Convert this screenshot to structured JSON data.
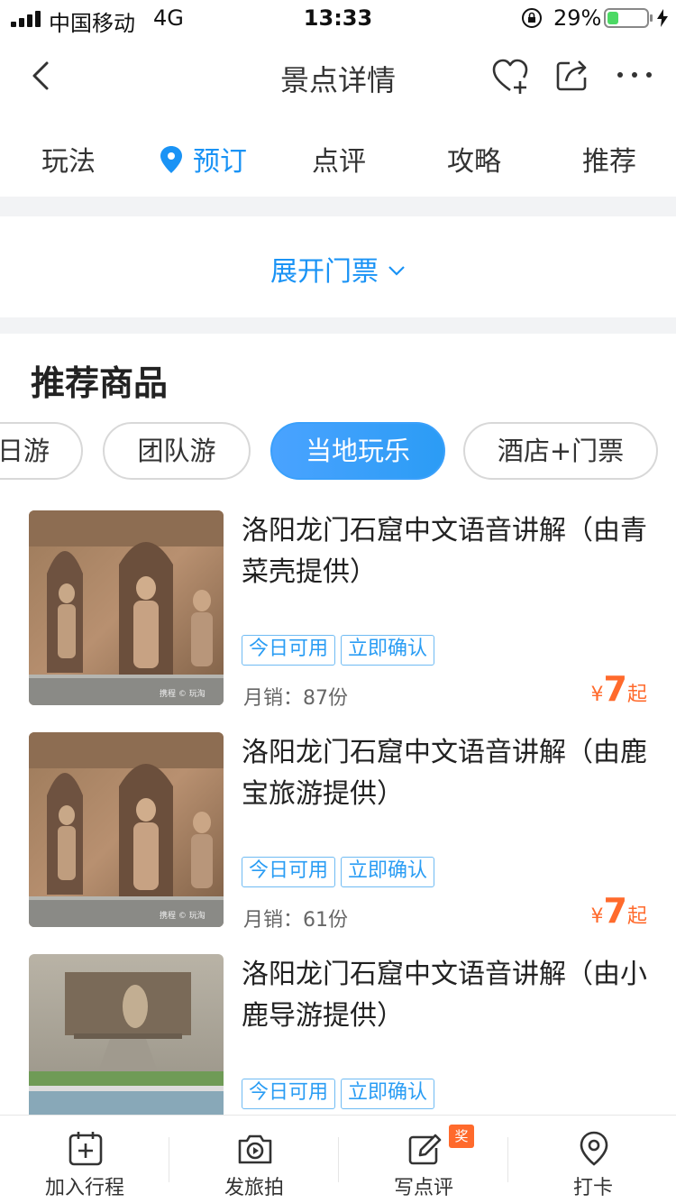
{
  "status_bar": {
    "carrier": "中国移动",
    "network": "4G",
    "time": "13:33",
    "battery_percent_text": "29%",
    "battery_level": 0.29
  },
  "nav": {
    "title": "景点详情",
    "icons": [
      "back-icon",
      "heart-add-icon",
      "share-icon",
      "more-icon"
    ]
  },
  "tabs": [
    {
      "label": "玩法",
      "active": false
    },
    {
      "label": "预订",
      "active": true
    },
    {
      "label": "点评",
      "active": false
    },
    {
      "label": "攻略",
      "active": false
    },
    {
      "label": "推荐",
      "active": false
    }
  ],
  "expand": {
    "label": "展开门票"
  },
  "section": {
    "title": "推荐商品"
  },
  "chips": [
    {
      "label": "日游",
      "active": false
    },
    {
      "label": "团队游",
      "active": false
    },
    {
      "label": "当地玩乐",
      "active": true
    },
    {
      "label": "酒店+门票",
      "active": false
    }
  ],
  "products": [
    {
      "title": "洛阳龙门石窟中文语音讲解（由青菜壳提供）",
      "tags": [
        "今日可用",
        "立即确认"
      ],
      "sales": "月销：87份",
      "price_currency": "¥",
      "price_value": "7",
      "price_suffix": "起",
      "watermark": "携程 © 玩淘"
    },
    {
      "title": "洛阳龙门石窟中文语音讲解（由鹿宝旅游提供）",
      "tags": [
        "今日可用",
        "立即确认"
      ],
      "sales": "月销：61份",
      "price_currency": "¥",
      "price_value": "7",
      "price_suffix": "起",
      "watermark": "携程 © 玩淘"
    },
    {
      "title": "洛阳龙门石窟中文语音讲解（由小鹿导游提供）",
      "tags": [
        "今日可用",
        "立即确认"
      ]
    }
  ],
  "bottom_bar": [
    {
      "label": "加入行程",
      "icon": "calendar-add-icon"
    },
    {
      "label": "发旅拍",
      "icon": "camera-icon"
    },
    {
      "label": "写点评",
      "icon": "edit-icon",
      "badge": "奖"
    },
    {
      "label": "打卡",
      "icon": "location-pin-icon"
    }
  ],
  "colors": {
    "accent": "#1a93f5",
    "price": "#ff6a2c",
    "battery": "#4cd964"
  }
}
